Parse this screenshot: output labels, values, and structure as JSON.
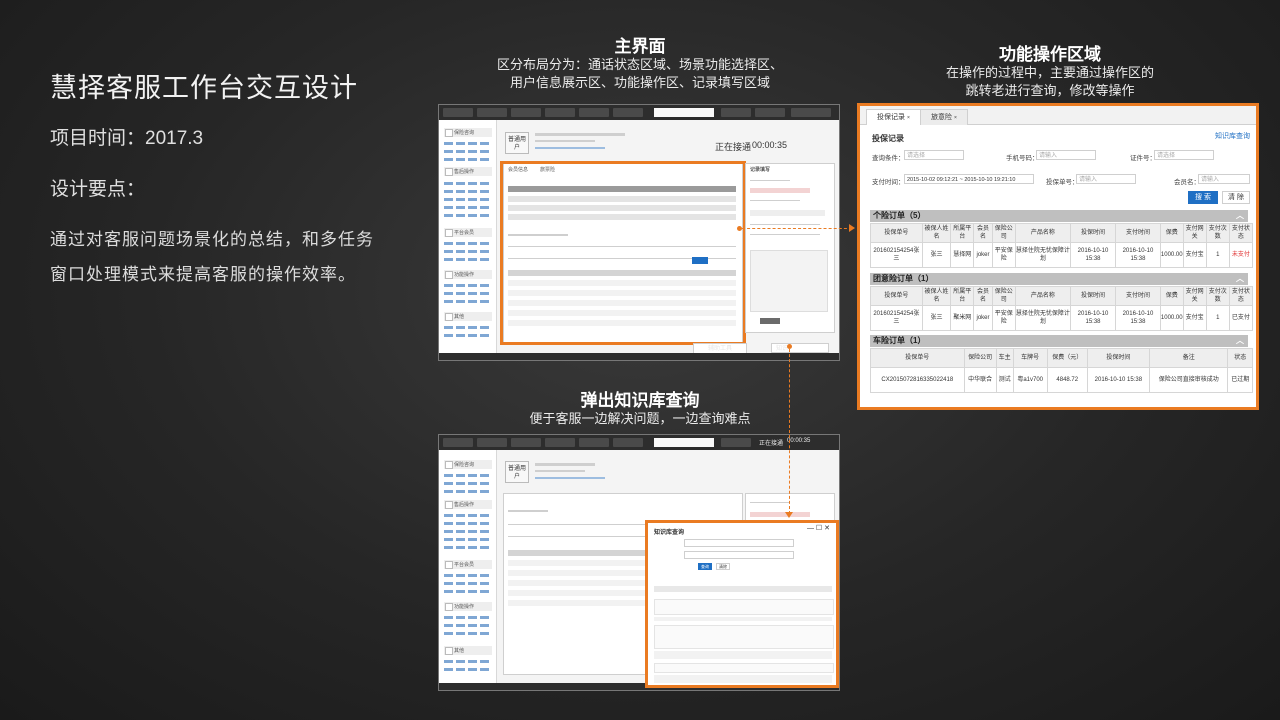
{
  "intro": {
    "title": "慧择客服工作台交互设计",
    "project_time": "项目时间：2017.3",
    "design_points": "设计要点：",
    "description_line1": "通过对客服问题场景化的总结，和多任务",
    "description_line2": "窗口处理模式来提高客服的操作效率。"
  },
  "captions": {
    "main_ui": {
      "title": "主界面",
      "line1": "区分布局分为：通话状态区域、场景功能选择区、",
      "line2": "用户信息展示区、功能操作区、记录填写区域"
    },
    "function_area": {
      "title": "功能操作区域",
      "line1": "在操作的过程中，主要通过操作区的",
      "line2": "跳转老进行查询，修改等操作"
    },
    "knowledge_popup": {
      "title": "弹出知识库查询",
      "line1": "便于客服一边解决问题，一边查询难点"
    }
  },
  "main_screenshot": {
    "user_type": "普通用户",
    "status": "正在接通",
    "timer": "00:00:35",
    "sidebar_groups": [
      "保险咨询",
      "售后操作",
      "平台会员",
      "功能操作",
      "其他"
    ],
    "tabs": [
      "会员信息",
      "旅票险"
    ],
    "record_title": "记录填写",
    "bottom_tabs": [
      "辅助工具",
      "知识"
    ]
  },
  "knowledge_screenshot": {
    "user_type": "普通用户",
    "status": "正在接通",
    "timer": "00:00:35",
    "sidebar_groups": [
      "保险咨询",
      "售后操作",
      "平台会员",
      "功能操作",
      "其他"
    ],
    "popup_title": "知识库查询",
    "query_button": "查询",
    "reset_button": "清除"
  },
  "function_panel": {
    "tabs": [
      "投保记录",
      "旅意险"
    ],
    "section_title": "投保记录",
    "kb_link": "知识库查询",
    "filters": {
      "name_label": "查询条件：",
      "name_placeholder": "请选择",
      "phone_label": "手机号码：",
      "phone_placeholder": "请输入",
      "cert_label": "证件号：",
      "cert_placeholder": "请选择",
      "pay_time_label": "支付时间：",
      "pay_time_value": "2015-10-02 09:12:21 ~ 2015-10-10 19:21:10",
      "policy_label": "投保单号：",
      "policy_placeholder": "请输入",
      "member_label": "会员名：",
      "member_placeholder": "请输入",
      "search_button": "搜 索",
      "clear_button": "清 除"
    },
    "sections": [
      {
        "title": "个险订单（5）",
        "headers": [
          "投保单号",
          "被保人姓名",
          "所属平台",
          "会员名",
          "保险公司",
          "产品名称",
          "投保时间",
          "支付时间",
          "保费",
          "支付网关",
          "支付次数",
          "支付状态"
        ],
        "rows": [
          [
            "201602154254张三",
            "张三",
            "慧择网",
            "joker",
            "平安保险",
            "慧择住院无忧保障计划",
            "2016-10-10 15:38",
            "2016-10-10 15:38",
            "1000.00",
            "支付宝",
            "1",
            "未支付"
          ]
        ]
      },
      {
        "title": "团意险订单（1）",
        "headers": [
          "投保单号",
          "被保人姓名",
          "所属平台",
          "会员名",
          "保险公司",
          "产品名称",
          "投保时间",
          "支付时间",
          "保费",
          "支付网关",
          "支付次数",
          "支付状态"
        ],
        "rows": [
          [
            "201602154254张三",
            "张三",
            "聚米网",
            "joker",
            "平安保险",
            "慧择住院无忧保障计划",
            "2016-10-10 15:38",
            "2016-10-10 15:38",
            "1000.00",
            "支付宝",
            "1",
            "已支付"
          ]
        ]
      },
      {
        "title": "车险订单（1）",
        "headers": [
          "投保单号",
          "保险公司",
          "车主",
          "车牌号",
          "保费（元）",
          "投保时间",
          "备注",
          "状态"
        ],
        "rows": [
          [
            "CX2015072816335022418",
            "中华联合",
            "测试",
            "粤a1v700",
            "4848.72",
            "2016-10-10 15:38",
            "保险公司直接审核成功",
            "已过期"
          ]
        ]
      }
    ],
    "colors": {
      "accent": "#ea7b22",
      "primary": "#1f6fc4",
      "unpaid": "#e03030",
      "section_header": "#bfbfbf"
    }
  }
}
